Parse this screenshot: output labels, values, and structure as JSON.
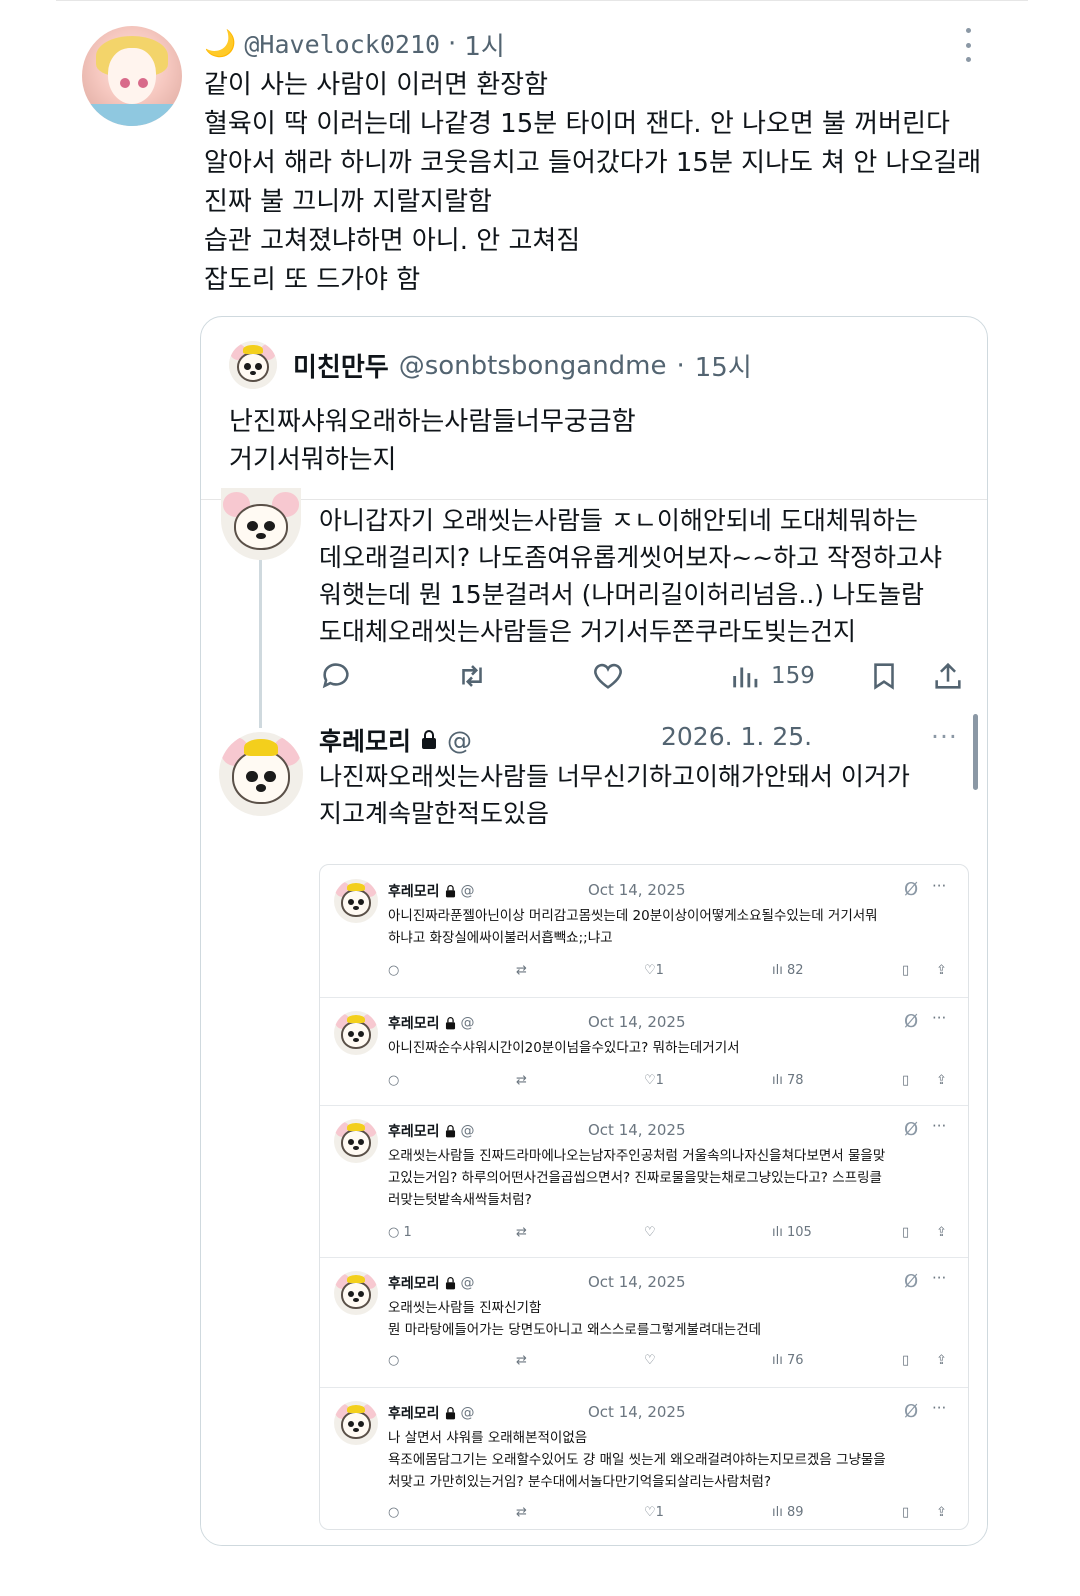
{
  "main_tweet": {
    "moon_icon": "🌙",
    "handle": "@Havelock0210",
    "separator": "·",
    "time": "1시",
    "lines": [
      "같이 사는 사람이 이러면 환장함",
      "혈육이 딱 이러는데 나같경 15분 타이머 잰다. 안 나오면 불 꺼버린다",
      "알아서 해라 하니까 코웃음치고 들어갔다가 15분 지나도 쳐 안 나오길래",
      "진짜 불 끄니까 지랄지랄함",
      "습관 고쳐졌냐하면 아니. 안 고쳐짐",
      "잡도리 또 드가야 함"
    ]
  },
  "quoted_tweet": {
    "name": "미친만두",
    "handle": "@sonbtsbongandme",
    "separator": "·",
    "time": "15시",
    "lines": [
      "난진짜샤워오래하는사람들너무궁금함",
      "거기서뭐하는지"
    ]
  },
  "reply1": {
    "lines": [
      "아니갑자기 오래씻는사람들 ㅈㄴ이해안되네 도대체뭐하는",
      "데오래걸리지? 나도좀여유롭게씻어보자~~하고 작정하고샤",
      "워햇는데 뭔 15분걸려서 (나머리길이허리넘음..) 나도놀람",
      "도대체오래씻는사람들은 거기서두쫀쿠라도빚는건지"
    ],
    "views": "159"
  },
  "reply2": {
    "name": "후레모리",
    "at": "@",
    "date": "2026. 1. 25.",
    "more": "···",
    "lines": [
      "나진짜오래씻는사람들 너무신기하고이해가안돼서 이거가",
      "지고계속말한적도있음"
    ]
  },
  "inner_tweets": [
    {
      "name": "후레모리",
      "at": "@",
      "date": "Oct 14, 2025",
      "lines": [
        "아니진짜라푼젤아닌이상 머리감고몸씻는데 20분이상이어떻게소요될수있는데 거기서뭐",
        "하냐고 화장실에싸이불러서흡빽쇼;;냐고"
      ],
      "replies": "",
      "likes": "1",
      "views": "82"
    },
    {
      "name": "후레모리",
      "at": "@",
      "date": "Oct 14, 2025",
      "lines": [
        "아니진짜순수샤워시간이20분이넘을수있다고? 뭐하는데거기서"
      ],
      "replies": "",
      "likes": "1",
      "views": "78"
    },
    {
      "name": "후레모리",
      "at": "@",
      "date": "Oct 14, 2025",
      "lines": [
        "오래씻는사람들 진짜드라마에나오는남자주인공처럼 거울속의나자신을쳐다보면서 물을맞",
        "고있는거임? 하루의어떤사건을곱씹으면서? 진짜로물을맞는채로그냥있는다고? 스프링클",
        "러맞는텃밭속새싹들처럼?"
      ],
      "replies": "1",
      "likes": "",
      "views": "105"
    },
    {
      "name": "후레모리",
      "at": "@",
      "date": "Oct 14, 2025",
      "lines": [
        "오래씻는사람들 진짜신기함",
        "뭔 마라탕에들어가는 당면도아니고 왜스스로를그렇게불려대는건데"
      ],
      "replies": "",
      "likes": "",
      "views": "76"
    },
    {
      "name": "후레모리",
      "at": "@",
      "date": "Oct 14, 2025",
      "lines": [
        "나 살면서 샤워를 오래해본적이없음",
        "욕조에몸담그기는 오래할수있어도 걍 매일 씻는게 왜오래걸려야하는지모르겠음 그냥물을",
        "처맞고 가만히있는거임? 분수대에서놀다만기억을되살리는사람처럼?"
      ],
      "replies": "",
      "likes": "1",
      "views": "89"
    }
  ],
  "icons": {
    "reply": "speech-bubble-icon",
    "retweet": "retweet-icon",
    "like": "heart-icon",
    "views": "bar-chart-icon",
    "bookmark": "bookmark-icon",
    "share": "share-icon",
    "lock": "lock-icon",
    "grok": "slash-circle-icon"
  }
}
